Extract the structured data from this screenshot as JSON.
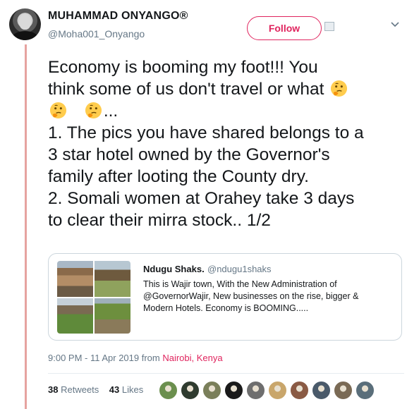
{
  "author": {
    "name": "MUHAMMAD ONYANGO®",
    "handle": "@Moha001_Onyango"
  },
  "follow_label": "Follow",
  "tweet": {
    "lines": [
      "Economy is booming my foot!!! You",
      "think some of us don't travel or what",
      "...",
      "1. The pics you have shared belongs to a",
      "3 star hotel owned by the Governor's",
      "family after looting the County dry.",
      "2. Somali women at Orahey take 3 days",
      "to clear their mirra stock.. 1/2"
    ],
    "emoji": "thinking-face"
  },
  "quoted": {
    "name": "Ndugu Shaks.",
    "handle": "@ndugu1shaks",
    "lines": [
      "This is Wajir town, With the New Administration of",
      "@GovernorWajir, New businesses on the rise, bigger &",
      "Modern Hotels. Economy is BOOMING....."
    ]
  },
  "meta": {
    "time": "9:00 PM - 11 Apr 2019 from ",
    "location": "Nairobi, Kenya"
  },
  "stats": {
    "retweets_count": "38",
    "retweets_label": "Retweets",
    "likes_count": "43",
    "likes_label": "Likes"
  },
  "colors": {
    "accent": "#e0245e",
    "thread_line": "#e6a3a0",
    "secondary_text": "#657786"
  },
  "likers": [
    {
      "color": "#6b8f4e"
    },
    {
      "color": "#2f3b2f"
    },
    {
      "color": "#7a7f5a"
    },
    {
      "color": "#1a1a1a"
    },
    {
      "color": "#6e6e6e"
    },
    {
      "color": "#c9a66b"
    },
    {
      "color": "#8a5a44"
    },
    {
      "color": "#4a5a6a"
    },
    {
      "color": "#7a6a55"
    },
    {
      "color": "#5a6e7a"
    }
  ]
}
